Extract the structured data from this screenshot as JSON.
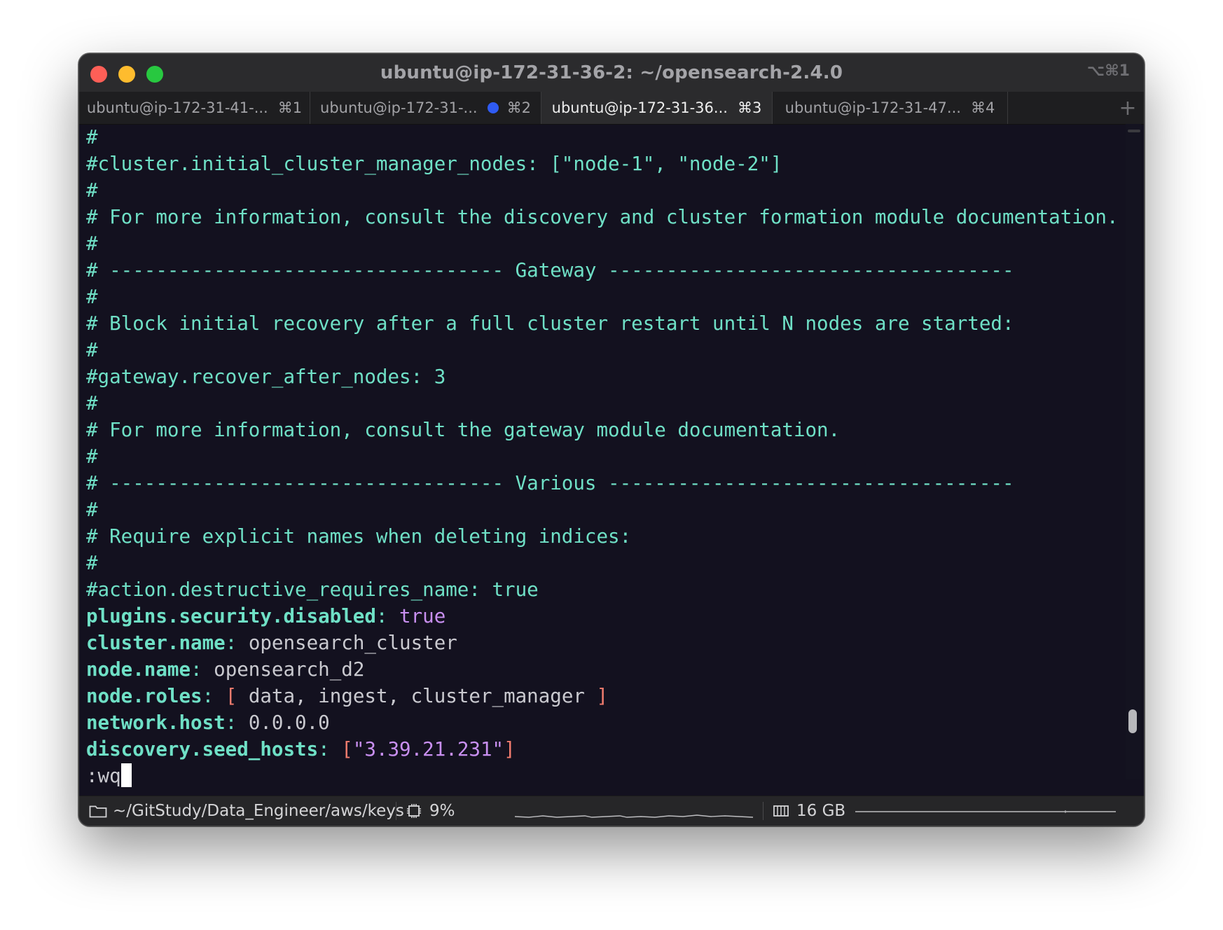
{
  "window": {
    "title": "ubuntu@ip-172-31-36-2: ~/opensearch-2.4.0",
    "title_shortcut": "⌥⌘1"
  },
  "tabs": [
    {
      "label": "ubuntu@ip-172-31-41-...",
      "shortcut": "⌘1",
      "active": false
    },
    {
      "label": "ubuntu@ip-172-31-...",
      "shortcut": "⌘2",
      "active": false,
      "activity_dot": true
    },
    {
      "label": "ubuntu@ip-172-31-36...",
      "shortcut": "⌘3",
      "active": true
    },
    {
      "label": "ubuntu@ip-172-31-47...",
      "shortcut": "⌘4",
      "active": false
    }
  ],
  "terminal": {
    "comment_lines": [
      "#",
      "#cluster.initial_cluster_manager_nodes: [\"node-1\", \"node-2\"]",
      "#",
      "# For more information, consult the discovery and cluster formation module documentation.",
      "#",
      "# ---------------------------------- Gateway -----------------------------------",
      "#",
      "# Block initial recovery after a full cluster restart until N nodes are started:",
      "#",
      "#gateway.recover_after_nodes: 3",
      "#",
      "# For more information, consult the gateway module documentation.",
      "#",
      "# ---------------------------------- Various -----------------------------------",
      "#",
      "# Require explicit names when deleting indices:",
      "#",
      "#action.destructive_requires_name: true"
    ],
    "config": {
      "plugins_security_key": "plugins.security.disabled",
      "plugins_security_value": "true",
      "cluster_name_key": "cluster.name",
      "cluster_name_value": "opensearch_cluster",
      "node_name_key": "node.name",
      "node_name_value": "opensearch_d2",
      "node_roles_key": "node.roles",
      "node_roles_open": "[",
      "node_roles_value": " data, ingest, cluster_manager ",
      "node_roles_close": "]",
      "network_host_key": "network.host",
      "network_host_value": "0.0.0.0",
      "seed_hosts_key": "discovery.seed_hosts",
      "seed_hosts_open": "[",
      "seed_hosts_value": "\"3.39.21.231\"",
      "seed_hosts_close": "]",
      "colon": ": "
    },
    "command": ":wq"
  },
  "status": {
    "path": "~/GitStudy/Data_Engineer/aws/keys",
    "cpu": "9%",
    "memory": "16 GB"
  },
  "colors": {
    "comment": "#6fe0c6",
    "value": "#c9c9cf",
    "keyword_value": "#c88ff0",
    "bracket": "#f27c6e",
    "background": "#13111f"
  }
}
